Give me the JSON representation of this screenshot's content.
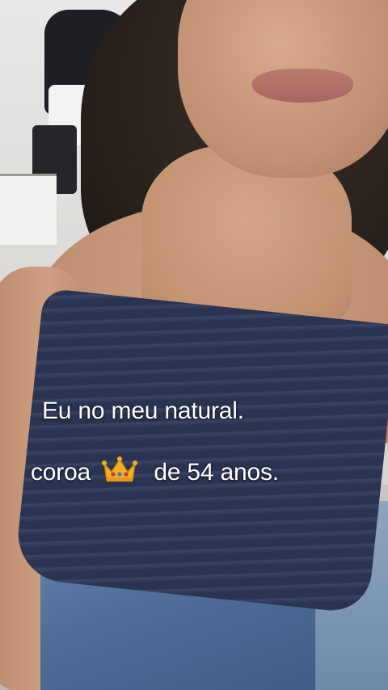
{
  "caption": {
    "line1": "Eu no meu natural.",
    "line2_before": "coroa",
    "line2_after": "de 54 anos."
  },
  "colors": {
    "caption_text": "#ffffff",
    "top": "#2a3350",
    "jeans": "#4f6e98"
  },
  "icons": {
    "crown": "crown-emoji-icon"
  }
}
